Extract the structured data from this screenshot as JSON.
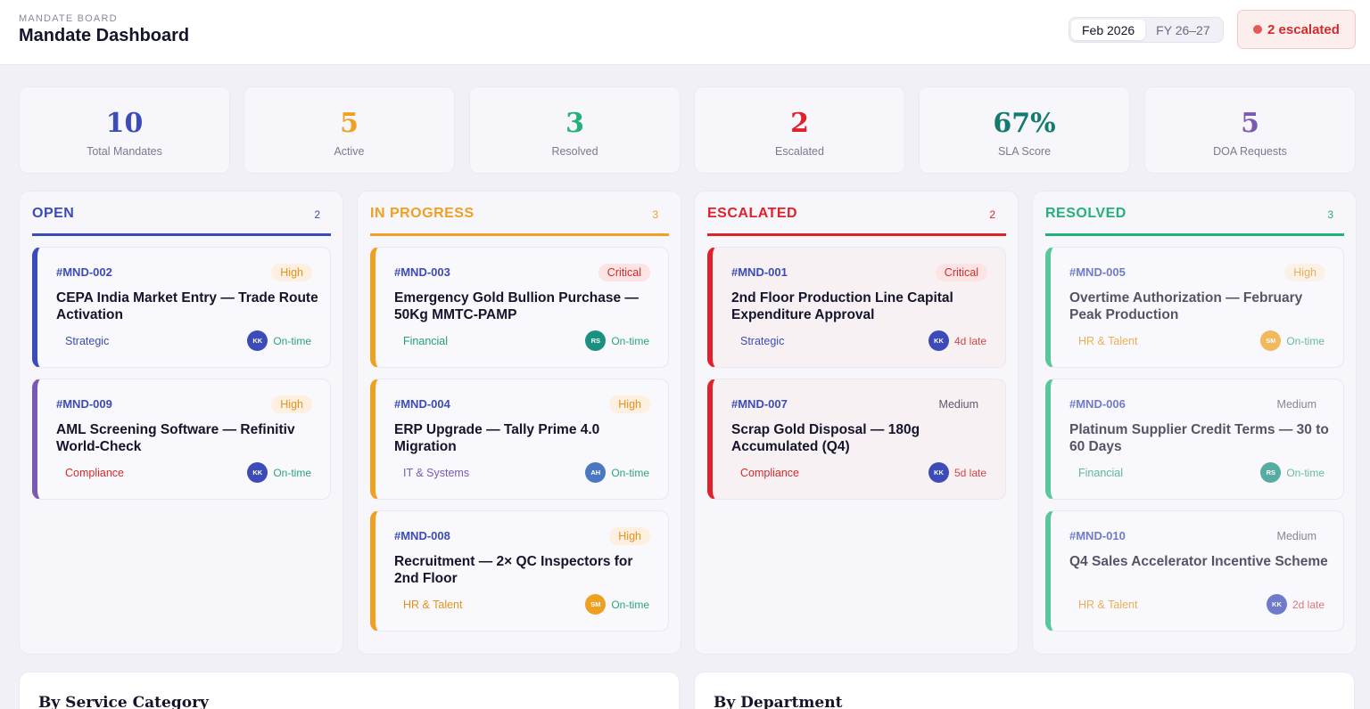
{
  "header": {
    "subtitle": "MANDATE BOARD",
    "title": "Mandate Dashboard",
    "periods": [
      "Feb 2026",
      "FY 26–27"
    ],
    "escalated_badge": "2 escalated"
  },
  "stats": [
    {
      "value": "10",
      "label": "Total Mandates",
      "color": "#3b4cb8"
    },
    {
      "value": "5",
      "label": "Active",
      "color": "#f0a020"
    },
    {
      "value": "3",
      "label": "Resolved",
      "color": "#24b07a"
    },
    {
      "value": "2",
      "label": "Escalated",
      "color": "#e0202a"
    },
    {
      "value": "67%",
      "label": "SLA Score",
      "color": "#157a6e"
    },
    {
      "value": "5",
      "label": "DOA Requests",
      "color": "#7a5ab0"
    }
  ],
  "columns": [
    {
      "title": "OPEN",
      "count": "2",
      "color": "#3b4cb8",
      "cards": [
        {
          "id": "#MND-002",
          "priority": "High",
          "title": "CEPA India Market Entry — Trade Route Activation",
          "category": "Strategic",
          "owner": "KK",
          "status": "On-time"
        },
        {
          "id": "#MND-009",
          "priority": "High",
          "title": "AML Screening Software — Refinitiv World-Check",
          "category": "Compliance",
          "owner": "KK",
          "status": "On-time"
        }
      ]
    },
    {
      "title": "IN PROGRESS",
      "count": "3",
      "color": "#f0a020",
      "cards": [
        {
          "id": "#MND-003",
          "priority": "Critical",
          "title": "Emergency Gold Bullion Purchase — 50Kg MMTC-PAMP",
          "category": "Financial",
          "owner": "RS",
          "status": "On-time"
        },
        {
          "id": "#MND-004",
          "priority": "High",
          "title": "ERP Upgrade — Tally Prime 4.0 Migration",
          "category": "IT & Systems",
          "owner": "AH",
          "status": "On-time"
        },
        {
          "id": "#MND-008",
          "priority": "High",
          "title": "Recruitment — 2× QC Inspectors for 2nd Floor",
          "category": "HR & Talent",
          "owner": "SM",
          "status": "On-time"
        }
      ]
    },
    {
      "title": "ESCALATED",
      "count": "2",
      "color": "#e0202a",
      "cards": [
        {
          "id": "#MND-001",
          "priority": "Critical",
          "title": "2nd Floor Production Line Capital Expenditure Approval",
          "category": "Strategic",
          "owner": "KK",
          "status": "4d late"
        },
        {
          "id": "#MND-007",
          "priority": "Medium",
          "title": "Scrap Gold Disposal — 180g Accumulated (Q4)",
          "category": "Compliance",
          "owner": "KK",
          "status": "5d late"
        }
      ]
    },
    {
      "title": "RESOLVED",
      "count": "3",
      "color": "#24b07a",
      "cards": [
        {
          "id": "#MND-005",
          "priority": "High",
          "title": "Overtime Authorization — February Peak Production",
          "category": "HR & Talent",
          "owner": "SM",
          "status": "On-time"
        },
        {
          "id": "#MND-006",
          "priority": "Medium",
          "title": "Platinum Supplier Credit Terms — 30 to 60 Days",
          "category": "Financial",
          "owner": "RS",
          "status": "On-time"
        },
        {
          "id": "#MND-010",
          "priority": "Medium",
          "title": "Q4 Sales Accelerator Incentive Scheme",
          "category": "HR & Talent",
          "owner": "KK",
          "status": "2d late"
        }
      ]
    }
  ],
  "panels": {
    "service_category": "By Service Category",
    "department": "By Department"
  },
  "colors": {
    "category": {
      "Strategic": "#3b4cb8",
      "Compliance": "#d42a2a",
      "Financial": "#24a070",
      "IT & Systems": "#7a5ab0",
      "HR & Talent": "#e6921a"
    },
    "owner": {
      "KK": "#3b4cb8",
      "RS": "#1a9080",
      "AH": "#4a78c0",
      "SM": "#f0a020"
    },
    "card_border": {
      "OPEN": [
        "#3b4cb8",
        "#7a5ab0"
      ],
      "IN PROGRESS": [
        "#f0a020",
        "#f0a020",
        "#f0a020"
      ],
      "ESCALATED": [
        "#e0202a",
        "#e0202a"
      ],
      "RESOLVED": [
        "#5ac79a",
        "#5ac79a",
        "#5ac79a"
      ]
    }
  }
}
